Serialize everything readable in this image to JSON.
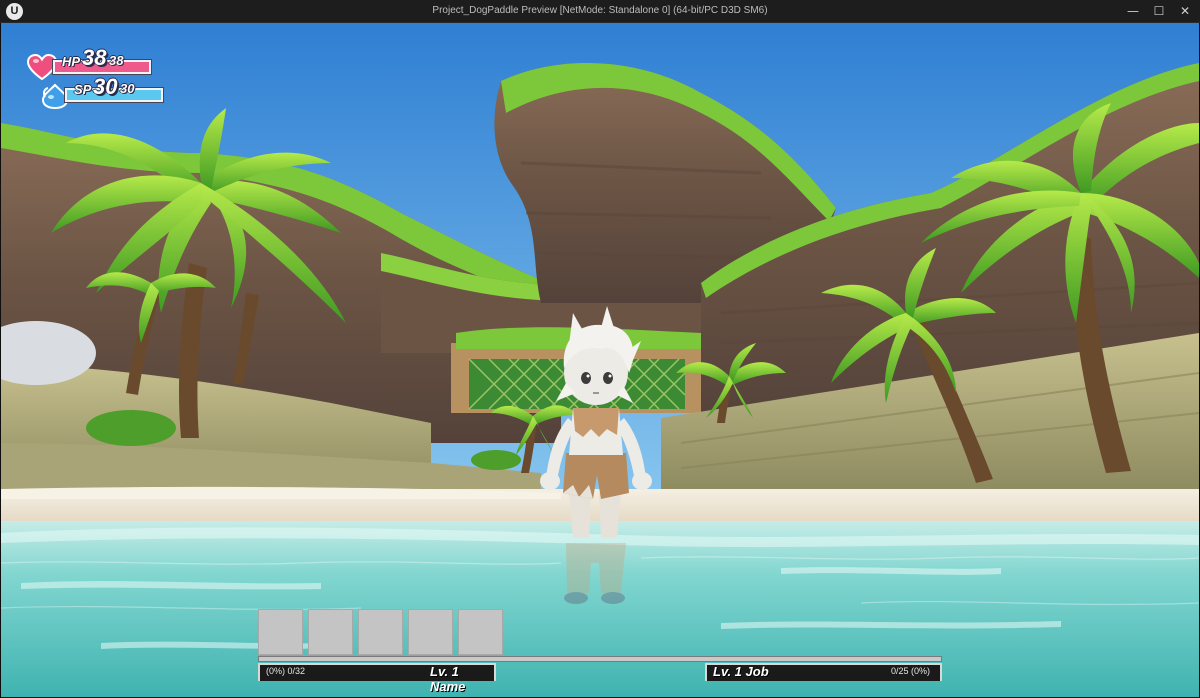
{
  "window": {
    "title": "Project_DogPaddle Preview [NetMode: Standalone 0]  (64-bit/PC D3D SM6)",
    "minimize_glyph": "—",
    "maximize_glyph": "☐",
    "close_glyph": "✕"
  },
  "hud": {
    "hp": {
      "label": "HP",
      "current": "38",
      "max": "38",
      "fill_fraction": 1.0,
      "color": "#ef5a8c",
      "icon": "heart-icon"
    },
    "sp": {
      "label": "SP",
      "current": "30",
      "max": "30",
      "fill_fraction": 1.0,
      "color": "#5ac8ef",
      "icon": "water-drop-icon"
    },
    "hotbar_slots": [
      "",
      "",
      "",
      "",
      ""
    ],
    "level_name": {
      "progress": "(0%) 0/32",
      "title": "Lv. 1 Name"
    },
    "level_job": {
      "title": "Lv. 1 Job",
      "progress": "0/25 (0%)"
    }
  },
  "colors": {
    "sky": "#4ea2e3",
    "grass": "#7cc83a",
    "rock": "#7d6452",
    "sand": "#ece4d4",
    "water": "#6fd1cb"
  }
}
